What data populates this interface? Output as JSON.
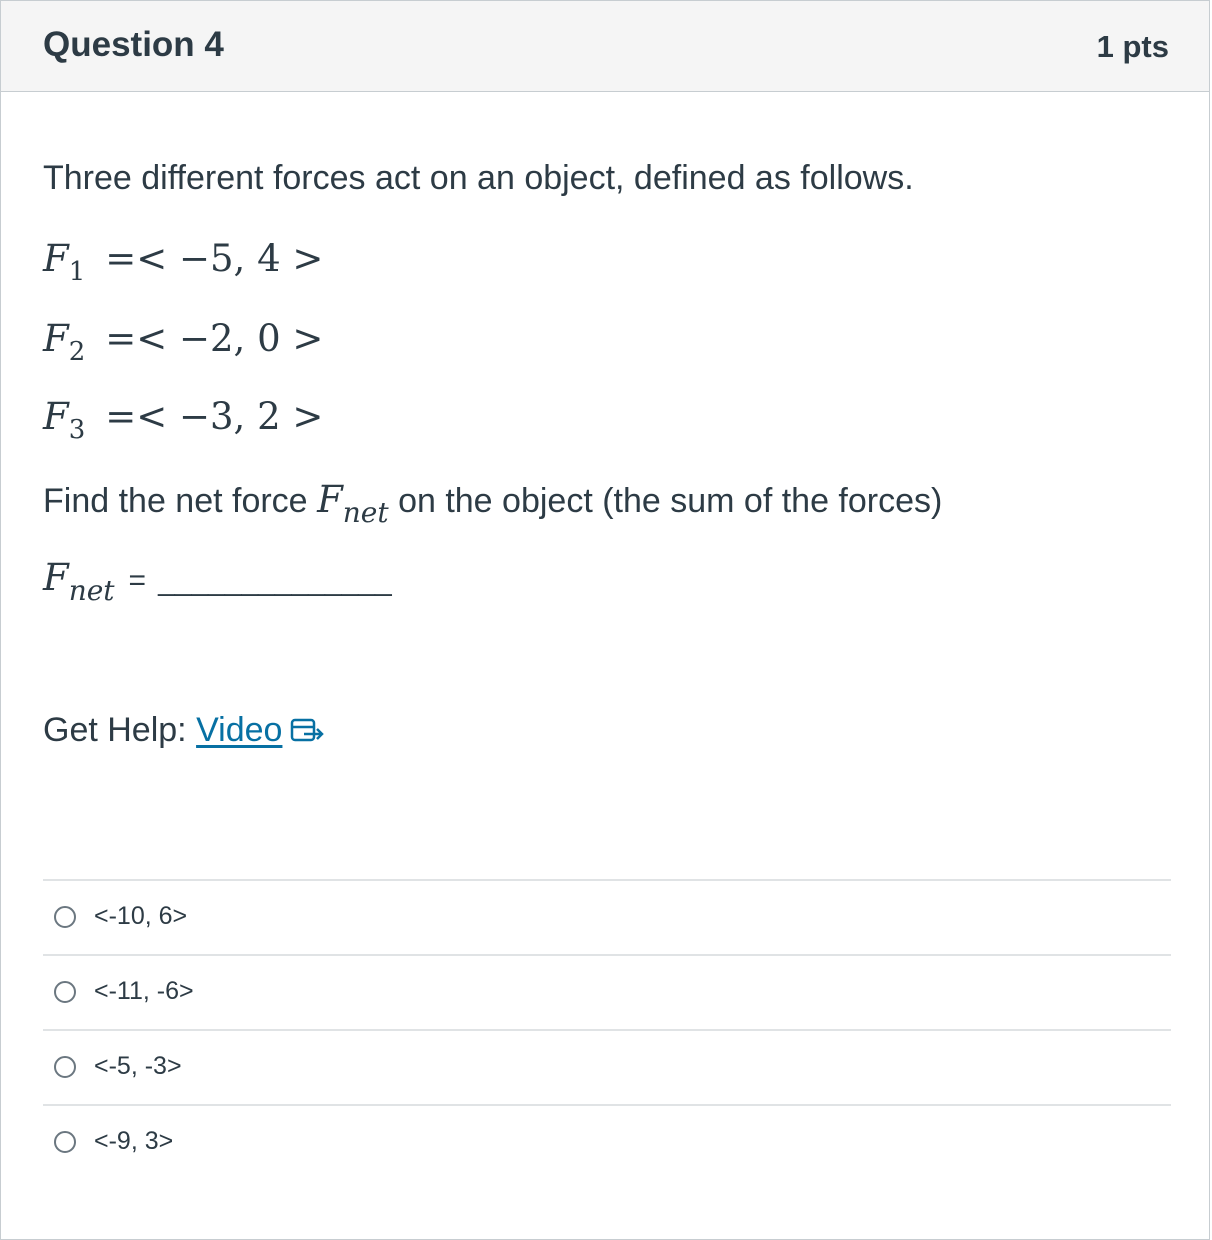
{
  "question": {
    "title": "Question 4",
    "points": "1 pts"
  },
  "body": {
    "intro": "Three different forces act on an object, defined as follows.",
    "forces": [
      {
        "symbol": "F",
        "subscript": "1",
        "value": "=< −5, 4 >"
      },
      {
        "symbol": "F",
        "subscript": "2",
        "value": "=< −2, 0 >"
      },
      {
        "symbol": "F",
        "subscript": "3",
        "value": "=< −3, 2 >"
      }
    ],
    "find_prefix": "Find the net force",
    "find_symbol": "F",
    "find_subscript": "net",
    "find_suffix": "on the object (the sum of the forces)",
    "answer_symbol": "F",
    "answer_subscript": "net",
    "answer_equals": "=",
    "answer_blank": "______________"
  },
  "help": {
    "prefix": "Get Help:",
    "link_label": "Video",
    "icon": "external-link-icon",
    "link_color": "#0770a3"
  },
  "answers": [
    {
      "label": "<-10, 6>",
      "selected": false
    },
    {
      "label": "<-11, -6>",
      "selected": false
    },
    {
      "label": "<-5, -3>",
      "selected": false
    },
    {
      "label": "<-9, 3>",
      "selected": false
    }
  ]
}
